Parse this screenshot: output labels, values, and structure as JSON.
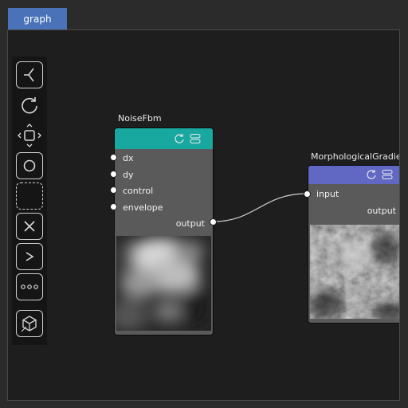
{
  "tab": {
    "label": "graph"
  },
  "toolbar": {
    "tools": [
      "split-node-icon",
      "refresh-icon",
      "move-icon",
      "circle-select-icon",
      "rect-select-icon",
      "delete-icon",
      "run-icon",
      "more-icon",
      "view-3d-icon"
    ]
  },
  "nodes": {
    "noise": {
      "title": "NoiseFbm",
      "header_color": "#19a8a0",
      "inputs": [
        "dx",
        "dy",
        "control",
        "envelope"
      ],
      "output": "output"
    },
    "morph": {
      "title": "MorphologicalGradient",
      "header_color": "#6068c4",
      "input": "input",
      "output": "output"
    }
  }
}
